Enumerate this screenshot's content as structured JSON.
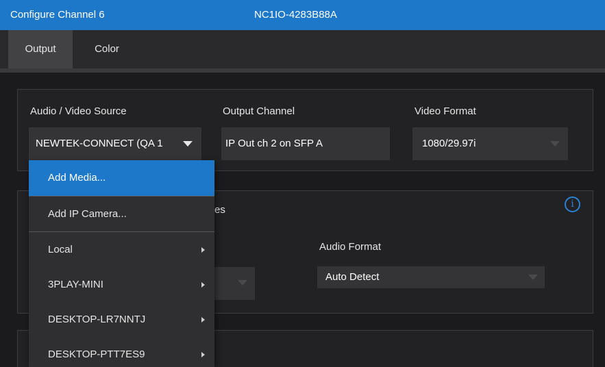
{
  "window": {
    "title": "Configure Channel 6",
    "device_name": "NC1IO-4283B88A"
  },
  "tabs": [
    {
      "label": "Output",
      "active": true
    },
    {
      "label": "Color",
      "active": false
    }
  ],
  "output_panel": {
    "av_source": {
      "label": "Audio / Video Source",
      "value": "NEWTEK-CONNECT (QA 1"
    },
    "output_channel": {
      "label": "Output Channel",
      "value": "IP Out ch 2 on SFP A"
    },
    "video_format": {
      "label": "Video Format",
      "value": "1080/29.97i"
    }
  },
  "audio_panel": {
    "partial_heading": "es",
    "audio_format": {
      "label": "Audio Format",
      "value": "Auto Detect"
    }
  },
  "dropdown_menu": {
    "items": [
      {
        "label": "Add Media...",
        "highlighted": true,
        "has_submenu": false
      },
      {
        "label": "Add IP Camera...",
        "highlighted": false,
        "has_submenu": false
      },
      {
        "label": "Local",
        "highlighted": false,
        "has_submenu": true
      },
      {
        "label": "3PLAY-MINI",
        "highlighted": false,
        "has_submenu": true
      },
      {
        "label": "DESKTOP-LR7NNTJ",
        "highlighted": false,
        "has_submenu": true
      },
      {
        "label": "DESKTOP-PTT7ES9",
        "highlighted": false,
        "has_submenu": true
      }
    ]
  },
  "colors": {
    "accent": "#1e78c9",
    "background": "#1b1b1d",
    "field": "#343436",
    "info_icon": "#2a82d8"
  },
  "icons": {
    "info": "info-circle-icon",
    "dropdown": "caret-down-icon",
    "submenu": "submenu-arrow-icon"
  }
}
